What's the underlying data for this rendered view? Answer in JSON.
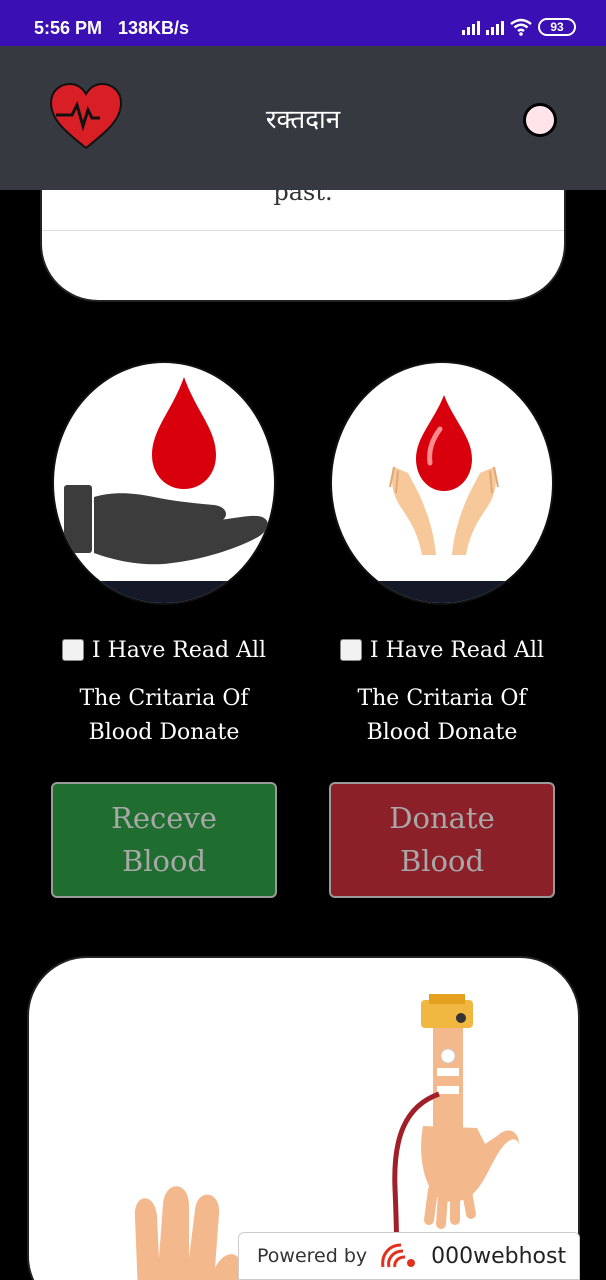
{
  "status_bar": {
    "time": "5:56 PM",
    "speed": "138KB/s",
    "battery": "93"
  },
  "header": {
    "title": "रक्तदान",
    "logo_icon": "heart-pulse-icon",
    "toggle_icon": "theme-toggle-icon"
  },
  "top_card": {
    "text": "past."
  },
  "receive": {
    "image_icon": "hand-blood-drop-icon",
    "checkbox_label": "I Have Read All",
    "criteria_text": "The Critaria Of Blood Donate",
    "button_label": "Receve Blood"
  },
  "donate": {
    "image_icon": "hands-blood-drop-icon",
    "checkbox_label": "I Have Read All",
    "criteria_text": "The Critaria Of Blood Donate",
    "button_label": "Donate Blood"
  },
  "footer_badge": {
    "label": "Powered by",
    "brand": "000webhost"
  },
  "colors": {
    "status_bar": "#3a0fb3",
    "header": "#363940",
    "receive_button": "#1f6e2f",
    "donate_button": "#8b2029",
    "blood": "#d8000c"
  }
}
